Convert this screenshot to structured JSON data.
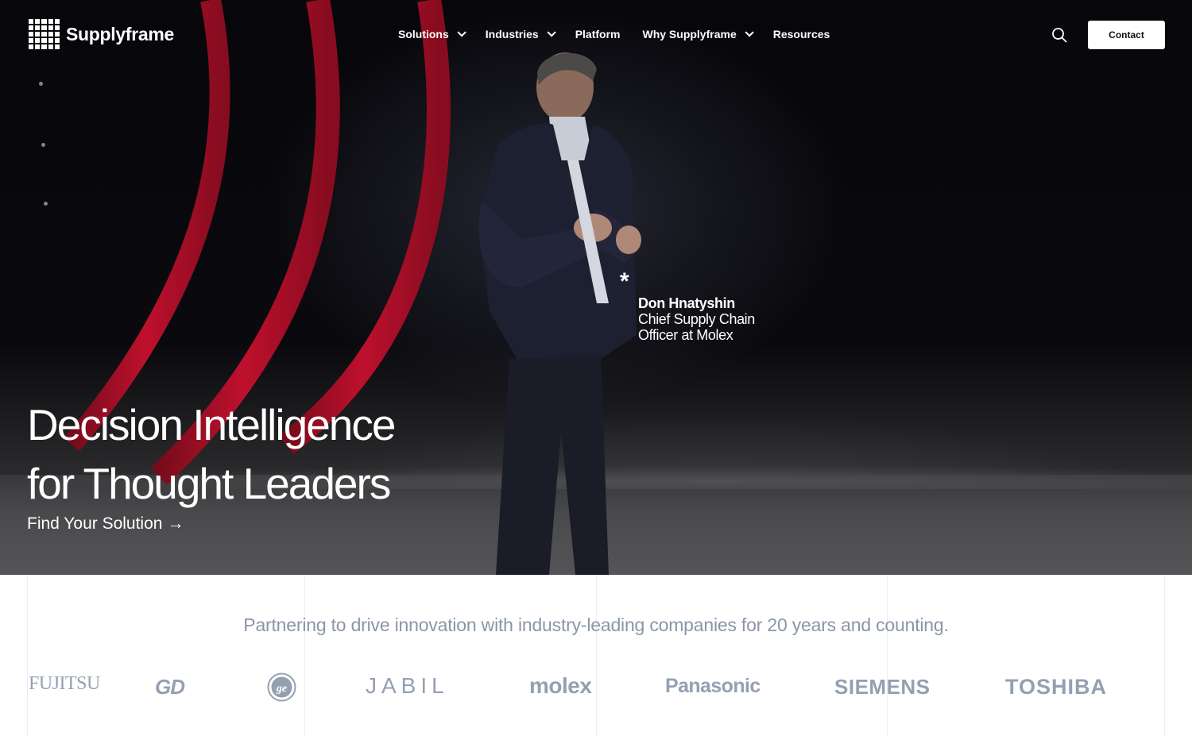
{
  "brand": {
    "name": "Supplyframe"
  },
  "nav": {
    "items": [
      {
        "label": "Solutions",
        "has_dropdown": true
      },
      {
        "label": "Industries",
        "has_dropdown": true
      },
      {
        "label": "Platform",
        "has_dropdown": false
      },
      {
        "label": "Why Supplyframe",
        "has_dropdown": true
      },
      {
        "label": "Resources",
        "has_dropdown": false
      }
    ],
    "search_icon": "search-icon",
    "contact_label": "Contact"
  },
  "hero": {
    "headline_line1": "Decision Intelligence",
    "headline_line2": "for Thought Leaders",
    "cta_label": "Find Your Solution",
    "cta_arrow": "→",
    "caption": {
      "marker": "*",
      "name": "Don Hnatyshin",
      "role_line1": "Chief Supply Chain",
      "role_line2": "Officer at Molex"
    }
  },
  "partners": {
    "tagline": "Partnering to drive innovation with industry-leading companies for 20 years and counting.",
    "logos": [
      "FUJITSU",
      "GD",
      "GE",
      "JABIL",
      "molex",
      "Panasonic",
      "SIEMENS",
      "TOSHIBA"
    ]
  },
  "colors": {
    "hero_bg": "#07070b",
    "arc_red": "#c8102e",
    "logo_gray": "#94a0b2",
    "tagline_gray": "#8a96a8"
  }
}
